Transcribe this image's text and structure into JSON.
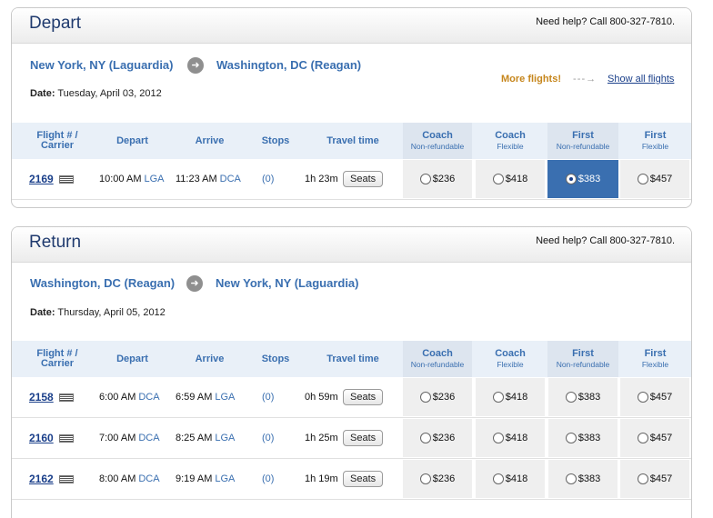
{
  "help_text": "Need help? Call 800-327-7810.",
  "depart": {
    "title": "Depart",
    "origin": "New York, NY (Laguardia)",
    "destination": "Washington, DC (Reagan)",
    "date_label": "Date:",
    "date_value": "Tuesday, April 03, 2012",
    "more_flights": "More flights!",
    "show_all": "Show all flights",
    "flights": [
      {
        "number": "2169",
        "depart_time": "10:00 AM",
        "depart_code": "LGA",
        "arrive_time": "11:23 AM",
        "arrive_code": "DCA",
        "stops": "(0)",
        "travel": "1h 23m",
        "fares": [
          "$236",
          "$418",
          "$383",
          "$457"
        ],
        "selected_fare": 2
      }
    ]
  },
  "return": {
    "title": "Return",
    "origin": "Washington, DC (Reagan)",
    "destination": "New York, NY (Laguardia)",
    "date_label": "Date:",
    "date_value": "Thursday, April 05, 2012",
    "flights": [
      {
        "number": "2158",
        "depart_time": "6:00 AM",
        "depart_code": "DCA",
        "arrive_time": "6:59 AM",
        "arrive_code": "LGA",
        "stops": "(0)",
        "travel": "0h 59m",
        "fares": [
          "$236",
          "$418",
          "$383",
          "$457"
        ]
      },
      {
        "number": "2160",
        "depart_time": "7:00 AM",
        "depart_code": "DCA",
        "arrive_time": "8:25 AM",
        "arrive_code": "LGA",
        "stops": "(0)",
        "travel": "1h 25m",
        "fares": [
          "$236",
          "$418",
          "$383",
          "$457"
        ]
      },
      {
        "number": "2162",
        "depart_time": "8:00 AM",
        "depart_code": "DCA",
        "arrive_time": "9:19 AM",
        "arrive_code": "LGA",
        "stops": "(0)",
        "travel": "1h 19m",
        "fares": [
          "$236",
          "$418",
          "$383",
          "$457"
        ]
      }
    ]
  },
  "table_headers": {
    "flight": "Flight # /",
    "flight_sub": "Carrier",
    "depart": "Depart",
    "arrive": "Arrive",
    "stops": "Stops",
    "travel": "Travel time",
    "coach": "Coach",
    "first": "First",
    "nonrefundable": "Non-refundable",
    "flexible": "Flexible"
  },
  "seats_label": "Seats",
  "colors": {
    "accent": "#3a6fb0",
    "title": "#1f3a6e",
    "highlight": "#c6861c",
    "selected": "#3a6fb0"
  },
  "icons": [
    "arrow-right-icon",
    "us-flag-icon",
    "radio-icon",
    "dashed-arrow-icon"
  ]
}
